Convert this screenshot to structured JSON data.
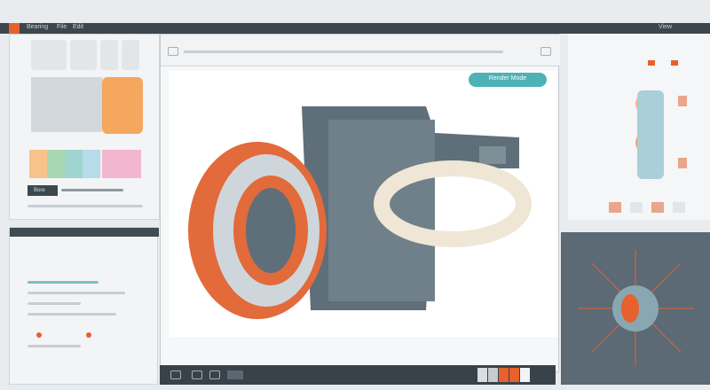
{
  "app": {
    "tab_labels": [
      "Bearing",
      "File",
      "Edit"
    ],
    "top_right_label": "View"
  },
  "toolbar": {
    "action_button_label": "Render Mode"
  },
  "left_panel": {
    "tag_label": "Bore"
  },
  "colors": {
    "accent": "#e8602c",
    "teal": "#4db1b5",
    "dark": "#3a4249",
    "ring": "#e36a3a",
    "steel": "#5f6f79"
  },
  "icons": {
    "arrow": "arrow-icon",
    "pencil": "pencil-icon",
    "layers": "layers-icon",
    "eye": "eye-icon"
  }
}
